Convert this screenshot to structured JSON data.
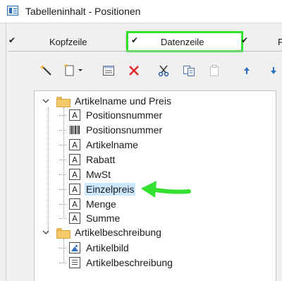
{
  "window": {
    "title": "Tabelleninhalt - Positionen"
  },
  "tabs": [
    {
      "label": "Kopfzeile",
      "checked": true,
      "active": false
    },
    {
      "label": "Datenzeile",
      "checked": true,
      "active": true
    },
    {
      "label": "F",
      "checked": true,
      "active": false
    }
  ],
  "toolbar": {
    "buttons": [
      {
        "icon": "magic-wand-icon"
      },
      {
        "icon": "new-item-dropdown-icon"
      },
      {
        "icon": "properties-icon"
      },
      {
        "icon": "delete-icon"
      },
      {
        "icon": "cut-icon"
      },
      {
        "icon": "copy-icon"
      },
      {
        "icon": "paste-icon"
      },
      {
        "icon": "move-up-icon"
      },
      {
        "icon": "move-down-icon"
      }
    ]
  },
  "tree": {
    "groups": [
      {
        "label": "Artikelname und Preis",
        "expanded": true,
        "items": [
          {
            "label": "Positionsnummer",
            "icon": "text-field-icon"
          },
          {
            "label": "Positionsnummer",
            "icon": "barcode-icon"
          },
          {
            "label": "Artikelname",
            "icon": "text-field-icon"
          },
          {
            "label": "Rabatt",
            "icon": "text-field-icon"
          },
          {
            "label": "MwSt",
            "icon": "text-field-icon"
          },
          {
            "label": "Einzelpreis",
            "icon": "text-field-icon",
            "selected": true
          },
          {
            "label": "Menge",
            "icon": "text-field-icon"
          },
          {
            "label": "Summe",
            "icon": "text-field-icon"
          }
        ]
      },
      {
        "label": "Artikelbeschreibung",
        "expanded": true,
        "items": [
          {
            "label": "Artikelbild",
            "icon": "image-field-icon"
          },
          {
            "label": "Artikelbeschreibung",
            "icon": "textblock-field-icon"
          }
        ]
      }
    ]
  },
  "field_icon_glyph": "A",
  "colors": {
    "highlight_green": "#34e030",
    "selection": "#cce8ff",
    "delete_red": "#e0262a",
    "arrow_blue": "#2a6fc4"
  }
}
